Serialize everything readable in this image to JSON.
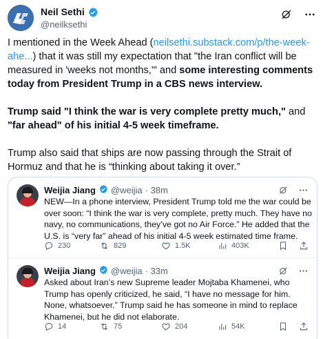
{
  "author": {
    "name": "Neil Sethi",
    "handle": "@neilksethi"
  },
  "post": {
    "p1_before": "I mentioned in the Week Ahead (",
    "p1_link": "neilsethi.substack.com/p/the-week-ahe...",
    "p1_after": ") that it was still my expectation that \"the Iran conflict will be measured in 'weeks not months,'\" and ",
    "p1_bold": "some interesting comments today from President Trump in a CBS news interview.",
    "p2_bold1": "Trump said \"I think the war is very complete pretty much,\"",
    "p2_mid": " and ",
    "p2_bold2": "\"far ahead\" of his initial 4-5 week timeframe.",
    "p3": "Trump also said that ships are now passing through the Strait of Hormuz and that he is “thinking about taking it over.”"
  },
  "quotes": [
    {
      "name": "Weijia Jiang",
      "handle": "@weijia",
      "time": "· 38m",
      "text": "NEW—In a phone interview, President Trump told me the war could be over soon: “I think the war is very complete, pretty much. They have no navy, no communications, they’ve got no Air Force.” He added that the U.S. is “very far” ahead of his initial 4-5 week estimated time frame.",
      "replies": "230",
      "reposts": "829",
      "likes": "1.5K",
      "views": "403K"
    },
    {
      "name": "Weijia Jiang",
      "handle": "@weijia",
      "time": "· 33m",
      "text": "Asked about Iran’s new Supreme leader Mojtaba Khamenei, who Trump has openly criticized, he said, “I have no message for him. None, whatsoever.” Trump said he has someone in mind to replace Khamenei, but he did not elaborate.",
      "replies": "14",
      "reposts": "75",
      "likes": "204",
      "views": "54K"
    }
  ],
  "colors": {
    "link": "#1d9bf0",
    "muted": "#536471",
    "border": "#cfd9de"
  },
  "icons": [
    "grok-icon",
    "more-icon",
    "verified-icon",
    "reply-icon",
    "repost-icon",
    "like-icon",
    "views-icon",
    "bookmark-icon",
    "share-icon"
  ]
}
